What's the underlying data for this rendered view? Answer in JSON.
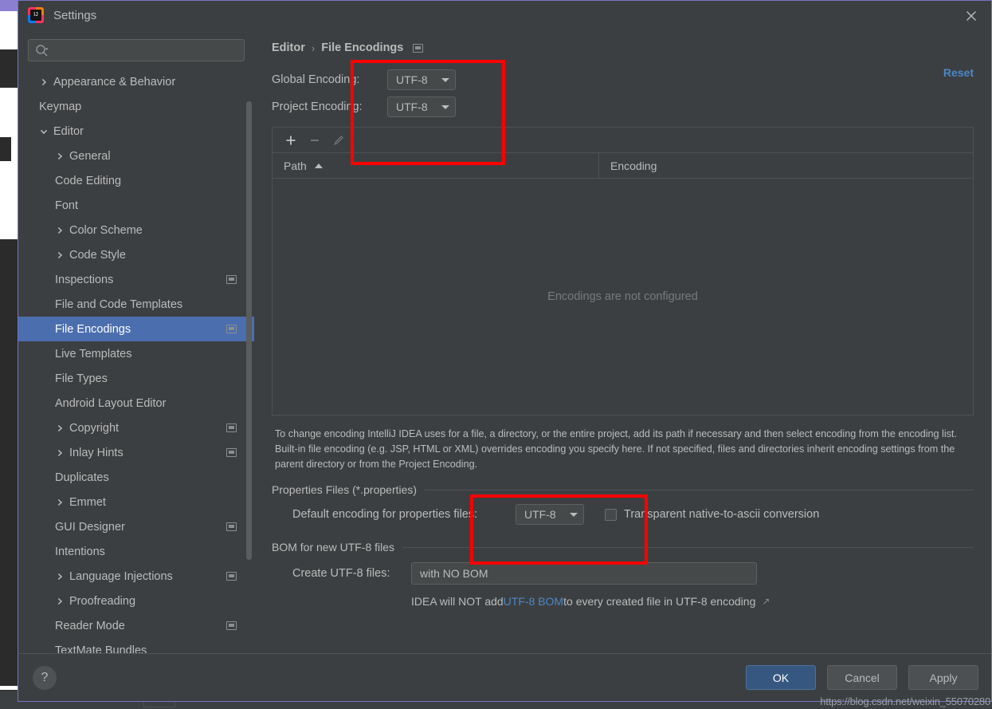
{
  "window": {
    "title": "Settings",
    "logo_text": "IJ",
    "close_icon": "close-icon"
  },
  "sidebar": {
    "search": {
      "placeholder": "",
      "value": "",
      "icon": "search-icon"
    },
    "items": [
      {
        "label": "Appearance & Behavior",
        "indent": 0,
        "arrow": "collapsed",
        "badge": false,
        "selected": false
      },
      {
        "label": "Keymap",
        "indent": 0,
        "arrow": "none",
        "badge": false,
        "selected": false
      },
      {
        "label": "Editor",
        "indent": 0,
        "arrow": "expanded",
        "badge": false,
        "selected": false
      },
      {
        "label": "General",
        "indent": 1,
        "arrow": "collapsed",
        "badge": false,
        "selected": false
      },
      {
        "label": "Code Editing",
        "indent": 1,
        "arrow": "none",
        "badge": false,
        "selected": false
      },
      {
        "label": "Font",
        "indent": 1,
        "arrow": "none",
        "badge": false,
        "selected": false
      },
      {
        "label": "Color Scheme",
        "indent": 1,
        "arrow": "collapsed",
        "badge": false,
        "selected": false
      },
      {
        "label": "Code Style",
        "indent": 1,
        "arrow": "collapsed",
        "badge": false,
        "selected": false
      },
      {
        "label": "Inspections",
        "indent": 1,
        "arrow": "none",
        "badge": true,
        "selected": false
      },
      {
        "label": "File and Code Templates",
        "indent": 1,
        "arrow": "none",
        "badge": false,
        "selected": false
      },
      {
        "label": "File Encodings",
        "indent": 1,
        "arrow": "none",
        "badge": true,
        "selected": true
      },
      {
        "label": "Live Templates",
        "indent": 1,
        "arrow": "none",
        "badge": false,
        "selected": false
      },
      {
        "label": "File Types",
        "indent": 1,
        "arrow": "none",
        "badge": false,
        "selected": false
      },
      {
        "label": "Android Layout Editor",
        "indent": 1,
        "arrow": "none",
        "badge": false,
        "selected": false
      },
      {
        "label": "Copyright",
        "indent": 1,
        "arrow": "collapsed",
        "badge": true,
        "selected": false
      },
      {
        "label": "Inlay Hints",
        "indent": 1,
        "arrow": "collapsed",
        "badge": true,
        "selected": false
      },
      {
        "label": "Duplicates",
        "indent": 1,
        "arrow": "none",
        "badge": false,
        "selected": false
      },
      {
        "label": "Emmet",
        "indent": 1,
        "arrow": "collapsed",
        "badge": false,
        "selected": false
      },
      {
        "label": "GUI Designer",
        "indent": 1,
        "arrow": "none",
        "badge": true,
        "selected": false
      },
      {
        "label": "Intentions",
        "indent": 1,
        "arrow": "none",
        "badge": false,
        "selected": false
      },
      {
        "label": "Language Injections",
        "indent": 1,
        "arrow": "collapsed",
        "badge": true,
        "selected": false
      },
      {
        "label": "Proofreading",
        "indent": 1,
        "arrow": "collapsed",
        "badge": false,
        "selected": false
      },
      {
        "label": "Reader Mode",
        "indent": 1,
        "arrow": "none",
        "badge": true,
        "selected": false
      },
      {
        "label": "TextMate Bundles",
        "indent": 1,
        "arrow": "none",
        "badge": false,
        "selected": false
      }
    ]
  },
  "content": {
    "breadcrumb": {
      "parent": "Editor",
      "separator": "›",
      "current": "File Encodings"
    },
    "reset_label": "Reset",
    "global_encoding": {
      "label": "Global Encoding:",
      "value": "UTF-8"
    },
    "project_encoding": {
      "label": "Project Encoding:",
      "value": "UTF-8"
    },
    "table_toolbar": {
      "add_icon": "plus-icon",
      "remove_icon": "minus-icon",
      "edit_icon": "pencil-icon"
    },
    "table": {
      "columns": [
        "Path",
        "Encoding"
      ],
      "sort_column": "Path",
      "sort_direction": "asc",
      "rows": [],
      "empty_text": "Encodings are not configured"
    },
    "description": "To change encoding IntelliJ IDEA uses for a file, a directory, or the entire project, add its path if necessary and then select encoding from the encoding list. Built-in file encoding (e.g. JSP, HTML or XML) overrides encoding you specify here. If not specified, files and directories inherit encoding settings from the parent directory or from the Project Encoding.",
    "properties_group": {
      "title": "Properties Files (*.properties)",
      "default_encoding_label": "Default encoding for properties files:",
      "default_encoding_value": "UTF-8",
      "transparent_label": "Transparent native-to-ascii conversion",
      "transparent_checked": false
    },
    "bom_group": {
      "title": "BOM for new UTF-8 files",
      "create_label": "Create UTF-8 files:",
      "create_value": "with NO BOM",
      "note_prefix": "IDEA will NOT add ",
      "note_link": "UTF-8 BOM",
      "note_suffix": " to every created file in UTF-8 encoding",
      "note_ext_icon": "external-link-icon"
    }
  },
  "footer": {
    "help_label": "?",
    "ok_label": "OK",
    "cancel_label": "Cancel",
    "apply_label": "Apply"
  },
  "watermark": "https://blog.csdn.net/weixin_55070280",
  "annotations": {
    "box1": "red-highlight-encoding-dropdowns",
    "box2": "red-highlight-properties-encoding"
  },
  "colors": {
    "accent_blue": "#4b6eaf",
    "link_blue": "#4a88c7",
    "annotation_red": "#ff0000",
    "dialog_bg": "#3c3f41",
    "text": "#bbbbbb"
  }
}
